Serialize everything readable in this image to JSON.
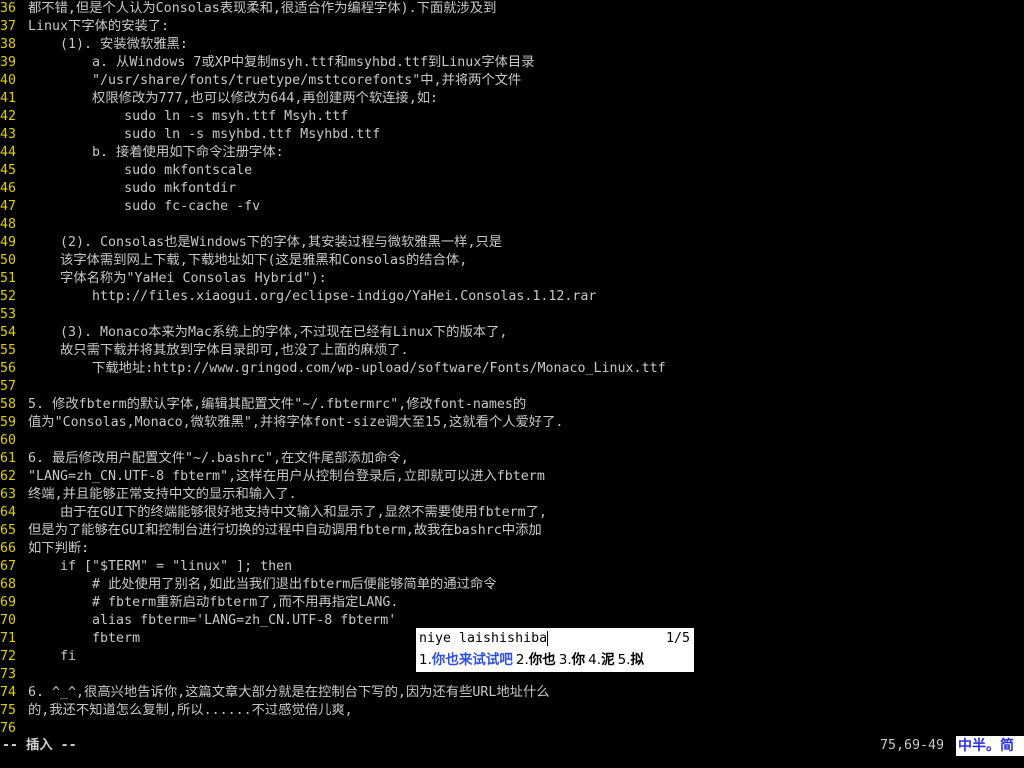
{
  "editor": {
    "lines": [
      {
        "n": "36",
        "text": "都不错,但是个人认为Consolas表现柔和,很适合作为编程字体).下面就涉及到"
      },
      {
        "n": "37",
        "text": "Linux下字体的安装了:"
      },
      {
        "n": "38",
        "text": "    (1). 安装微软雅黑:"
      },
      {
        "n": "39",
        "text": "        a. 从Windows 7或XP中复制msyh.ttf和msyhbd.ttf到Linux字体目录"
      },
      {
        "n": "40",
        "text": "        \"/usr/share/fonts/truetype/msttcorefonts\"中,并将两个文件"
      },
      {
        "n": "41",
        "text": "        权限修改为777,也可以修改为644,再创建两个软连接,如:"
      },
      {
        "n": "42",
        "text": "            sudo ln -s msyh.ttf Msyh.ttf"
      },
      {
        "n": "43",
        "text": "            sudo ln -s msyhbd.ttf Msyhbd.ttf"
      },
      {
        "n": "44",
        "text": "        b. 接着使用如下命令注册字体:"
      },
      {
        "n": "45",
        "text": "            sudo mkfontscale"
      },
      {
        "n": "46",
        "text": "            sudo mkfontdir"
      },
      {
        "n": "47",
        "text": "            sudo fc-cache -fv"
      },
      {
        "n": "48",
        "text": ""
      },
      {
        "n": "49",
        "text": "    (2). Consolas也是Windows下的字体,其安装过程与微软雅黑一样,只是"
      },
      {
        "n": "50",
        "text": "    该字体需到网上下载,下载地址如下(这是雅黑和Consolas的结合体,"
      },
      {
        "n": "51",
        "text": "    字体名称为\"YaHei Consolas Hybrid\"):"
      },
      {
        "n": "52",
        "text": "        http://files.xiaogui.org/eclipse-indigo/YaHei.Consolas.1.12.rar"
      },
      {
        "n": "53",
        "text": ""
      },
      {
        "n": "54",
        "text": "    (3). Monaco本来为Mac系统上的字体,不过现在已经有Linux下的版本了,"
      },
      {
        "n": "55",
        "text": "    故只需下载并将其放到字体目录即可,也没了上面的麻烦了."
      },
      {
        "n": "56",
        "text": "        下载地址:http://www.gringod.com/wp-upload/software/Fonts/Monaco_Linux.ttf"
      },
      {
        "n": "57",
        "text": ""
      },
      {
        "n": "58",
        "text": "5. 修改fbterm的默认字体,编辑其配置文件\"~/.fbtermrc\",修改font-names的"
      },
      {
        "n": "59",
        "text": "值为\"Consolas,Monaco,微软雅黑\",并将字体font-size调大至15,这就看个人爱好了."
      },
      {
        "n": "60",
        "text": ""
      },
      {
        "n": "61",
        "text": "6. 最后修改用户配置文件\"~/.bashrc\",在文件尾部添加命令,"
      },
      {
        "n": "62",
        "text": "\"LANG=zh_CN.UTF-8 fbterm\",这样在用户从控制台登录后,立即就可以进入fbterm"
      },
      {
        "n": "63",
        "text": "终端,并且能够正常支持中文的显示和输入了."
      },
      {
        "n": "64",
        "text": "    由于在GUI下的终端能够很好地支持中文输入和显示了,显然不需要使用fbterm了,"
      },
      {
        "n": "65",
        "text": "但是为了能够在GUI和控制台进行切换的过程中自动调用fbterm,故我在bashrc中添加"
      },
      {
        "n": "66",
        "text": "如下判断:"
      },
      {
        "n": "67",
        "text": "    if [\"$TERM\" = \"linux\" ]; then"
      },
      {
        "n": "68",
        "text": "        # 此处使用了别名,如此当我们退出fbterm后便能够简单的通过命令"
      },
      {
        "n": "69",
        "text": "        # fbterm重新启动fbterm了,而不用再指定LANG."
      },
      {
        "n": "70",
        "text": "        alias fbterm='LANG=zh_CN.UTF-8 fbterm'"
      },
      {
        "n": "71",
        "text": "        fbterm"
      },
      {
        "n": "72",
        "text": "    fi"
      },
      {
        "n": "73",
        "text": ""
      },
      {
        "n": "74",
        "text": "6. ^_^,很高兴地告诉你,这篇文章大部分就是在控制台下写的,因为还有些URL地址什么"
      },
      {
        "n": "75",
        "text": "的,我还不知道怎么复制,所以......不过感觉倍儿爽,"
      },
      {
        "n": "76",
        "text": ""
      }
    ]
  },
  "status": {
    "mode": "-- 插入 --",
    "cursor": "75,69-49",
    "ime_indicator": "中半。简"
  },
  "ime": {
    "input": "niye laishishiba",
    "page": "1/5",
    "candidates": [
      {
        "num": "1.",
        "word": "你也来试试吧"
      },
      {
        "num": "2.",
        "word": "你也"
      },
      {
        "num": "3.",
        "word": "你"
      },
      {
        "num": "4.",
        "word": "泥"
      },
      {
        "num": "5.",
        "word": "拟"
      }
    ]
  },
  "colors": {
    "background": "#000000",
    "line_number": "#e0d000",
    "text": "#c8c8c8",
    "ime_highlight": "#3050e0"
  }
}
